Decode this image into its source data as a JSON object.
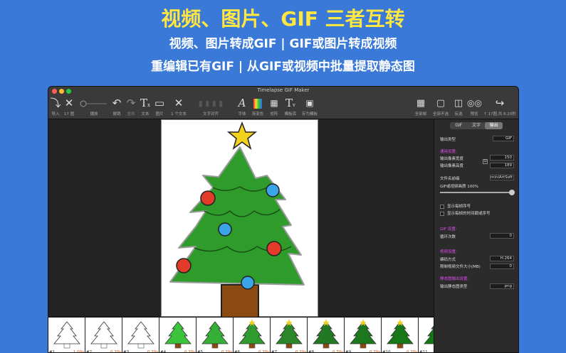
{
  "promo": {
    "headline": "视频、图片、GIF 三者互转",
    "line1": "视频、图片转成GIF | GIF或图片转成视频",
    "line2": "重编辑已有GIF | 从GIF或视频中批量提取静态图"
  },
  "window": {
    "title": "Timelapse GIF Maker",
    "traffic_colors": [
      "#ff5f57",
      "#febc2e",
      "#28c840"
    ]
  },
  "toolbar": {
    "import": "导入",
    "frame_count": "17 图",
    "play": "播放",
    "undo": "撤销",
    "redo": "重做",
    "text": "文本",
    "image": "图片",
    "text_count": "1 个文本",
    "align": "文字对齐",
    "font": "字体",
    "gradient": "渐变色",
    "matrix": "矩阵",
    "template": "模板库",
    "save_template": "存为模板",
    "select_all": "全部帧",
    "select_none": "全部不选",
    "invert": "反选",
    "preview": "预览",
    "info": "↑ 17图,共 8.20秒"
  },
  "side": {
    "tabs": [
      "GIF",
      "文字",
      "输出"
    ],
    "active_tab": 2,
    "output_type_label": "输出类型",
    "output_type_value": "GIF",
    "general_section": "通用设置:",
    "width_label": "输出像素宽度",
    "width_value": "150",
    "height_label": "输出像素高度",
    "height_value": "189",
    "prefix_label": "文件名前缀",
    "prefix_value": "miniArtSoft",
    "quality_label": "GIF或视频画质 100%",
    "quality": 0.97,
    "show_index": "显示每帧序号",
    "show_time": "显示每帧的时间戳或序号",
    "gif_section": "GIF 设置:",
    "loop_label": "循环次数",
    "loop_value": "0",
    "video_section": "视频设置:",
    "codec_label": "编码方式",
    "codec_value": "H.264",
    "size_label": "限制视频文件大小(MB)",
    "size_value": "0",
    "still_section": "静态图输出设置:",
    "still_label": "输出静态图类型",
    "still_value": "png"
  },
  "filmstrip": [
    {
      "num": "#1",
      "dur": "1.00s"
    },
    {
      "num": "#2",
      "dur": "0.20s"
    },
    {
      "num": "#3",
      "dur": "0.20s"
    },
    {
      "num": "#4",
      "dur": "0.20s"
    },
    {
      "num": "#5",
      "dur": "0.20s"
    },
    {
      "num": "#6",
      "dur": "0.20s"
    },
    {
      "num": "#7",
      "dur": "0.20s"
    },
    {
      "num": "#8",
      "dur": "0.70s"
    },
    {
      "num": "#9",
      "dur": "0.70s"
    },
    {
      "num": "#10",
      "dur": "0.20s"
    },
    {
      "num": "#11",
      "dur": ""
    }
  ]
}
